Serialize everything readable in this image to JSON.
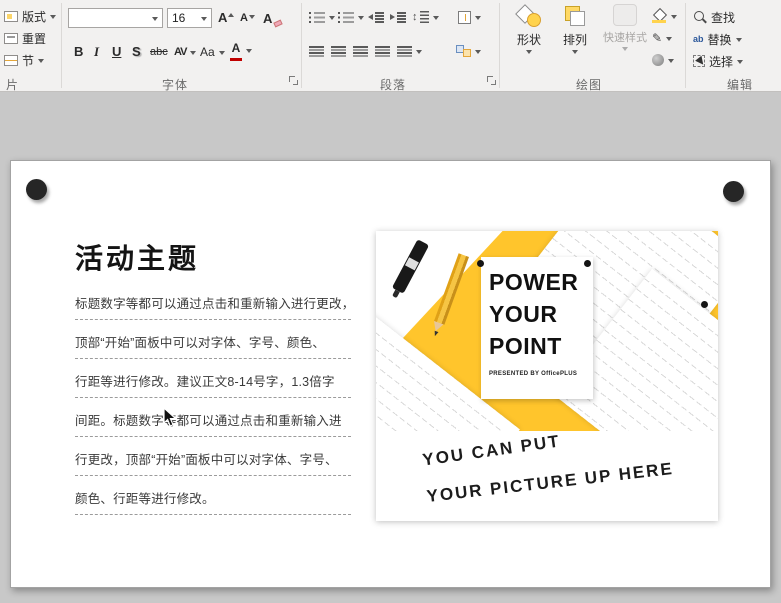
{
  "ribbon": {
    "slides_group": {
      "label": "片",
      "layout": "版式",
      "reset": "重置",
      "section": "节"
    },
    "font_group": {
      "label": "字体",
      "font_name_value": "",
      "font_size_value": "16",
      "grow_font_letter": "A",
      "shrink_font_letter": "A",
      "clear_format_letter": "A",
      "bold": "B",
      "italic": "I",
      "underline": "U",
      "shadow": "S",
      "strikethrough": "abc",
      "char_spacing": "AV",
      "change_case": "Aa",
      "font_color_letter": "A"
    },
    "paragraph_group": {
      "label": "段落"
    },
    "drawing_group": {
      "label": "绘图",
      "shapes": "形状",
      "arrange": "排列",
      "quick_styles": "快速样式"
    },
    "editing_group": {
      "label": "编辑",
      "find": "查找",
      "replace": "替换",
      "select": "选择"
    }
  },
  "slide": {
    "title": "活动主题",
    "body_lines": [
      "标题数字等都可以通过点击和重新输入进行更改，",
      "顶部“开始”面板中可以对字体、字号、颜色、",
      "行距等进行修改。建议正文8-14号字，1.3倍字",
      "间距。标题数字等都可以通过点击和重新输入进",
      "行更改，顶部“开始”面板中可以对字体、字号、",
      "颜色、行距等进行修改。"
    ],
    "photo": {
      "headline": [
        "POWER",
        "YOUR",
        "POINT"
      ],
      "byline": "PRESENTED BY OfficePLUS",
      "caption_line1": "YOU CAN PUT",
      "caption_line2": "YOUR PICTURE UP HERE"
    }
  },
  "icons": {
    "outline_pencil": "✎",
    "replace_glyph": "ab",
    "line_spacing_arrow": "↕"
  },
  "colors": {
    "accent_yellow": "#FFC52C",
    "canvas_gray": "#c8c8c8",
    "font_color_bar": "#C00000"
  }
}
